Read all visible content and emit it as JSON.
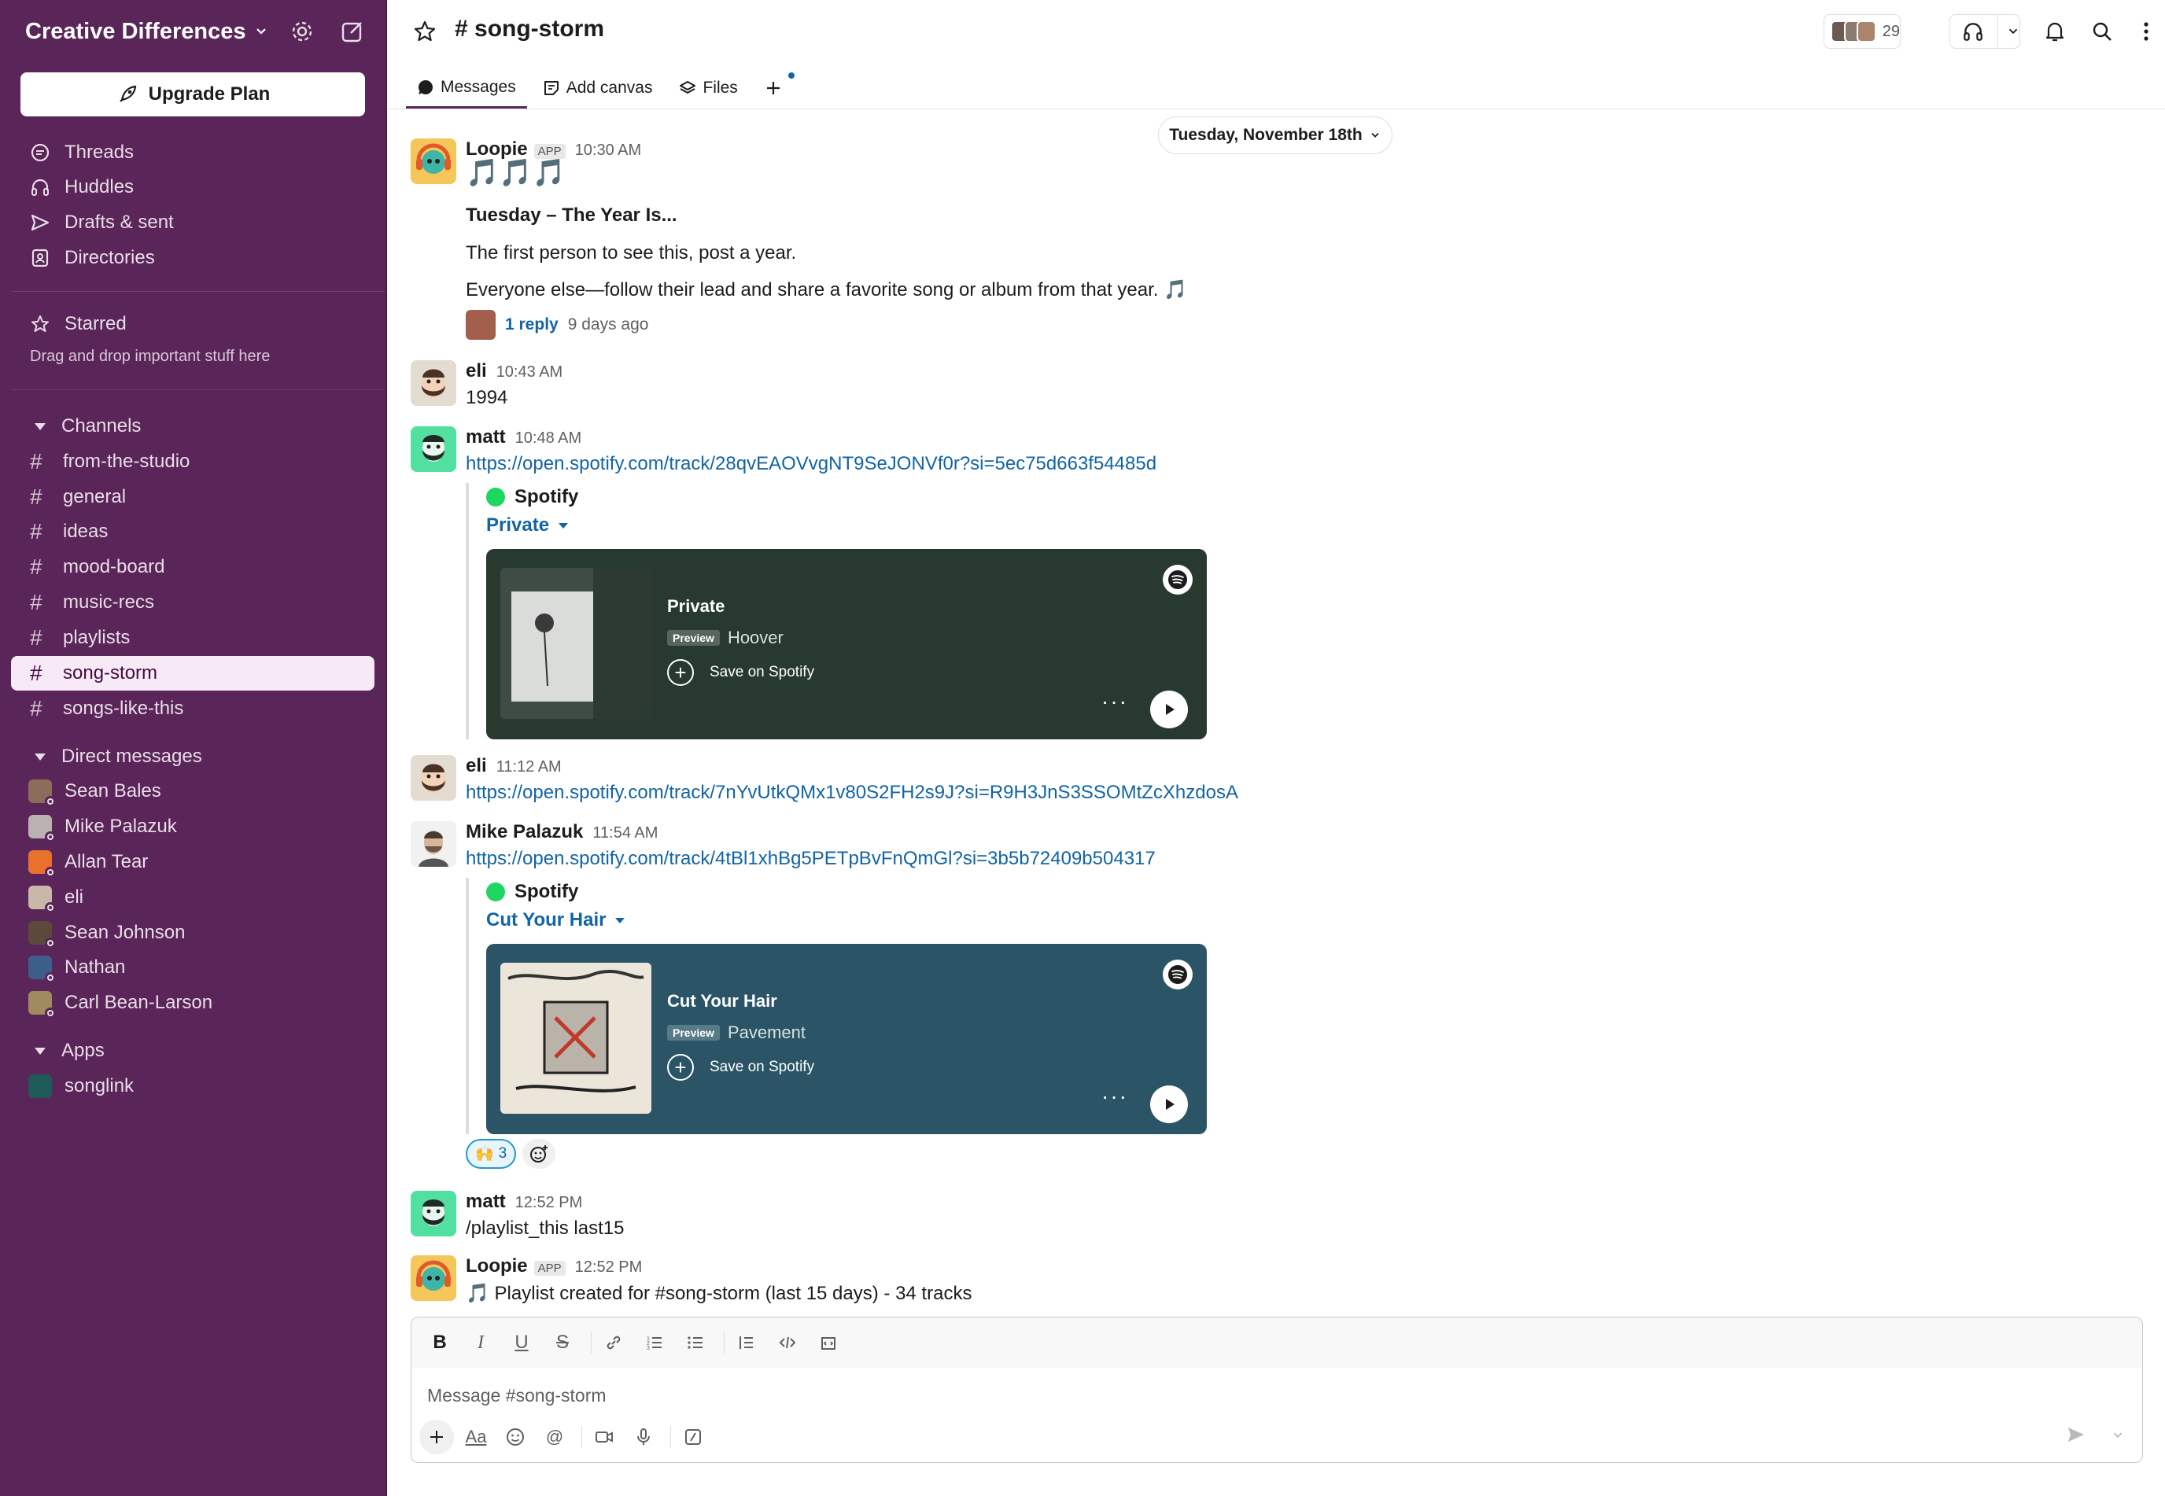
{
  "workspace": {
    "name": "Creative Differences",
    "upgrade_label": "Upgrade Plan"
  },
  "sidebar": {
    "nav": [
      {
        "label": "Threads",
        "icon": "threads-icon"
      },
      {
        "label": "Huddles",
        "icon": "headphones-icon"
      },
      {
        "label": "Drafts & sent",
        "icon": "send-icon"
      },
      {
        "label": "Directories",
        "icon": "directory-icon"
      }
    ],
    "starred_label": "Starred",
    "starred_hint": "Drag and drop important stuff here",
    "channels_label": "Channels",
    "channels": [
      "from-the-studio",
      "general",
      "ideas",
      "mood-board",
      "music-recs",
      "playlists",
      "song-storm",
      "songs-like-this"
    ],
    "active_channel": "song-storm",
    "dms_label": "Direct messages",
    "dms": [
      "Sean Bales",
      "Mike Palazuk",
      "Allan Tear",
      "eli",
      "Sean Johnson",
      "Nathan",
      "Carl Bean-Larson"
    ],
    "apps_label": "Apps",
    "apps": [
      "songlink"
    ]
  },
  "header": {
    "channel": "# song-storm",
    "member_count": "29",
    "tabs": [
      "Messages",
      "Add canvas",
      "Files"
    ]
  },
  "date_divider": "Tuesday, November 18th",
  "messages": [
    {
      "name": "Loopie",
      "badge": "APP",
      "time": "10:30 AM",
      "notes": "🎵🎵🎵",
      "title": "Tuesday – The Year Is...",
      "line1": "The first person to see this, post a year.",
      "line2": "Everyone else—follow their lead and share a favorite song or album from that year. 🎵",
      "reply_count": "1 reply",
      "reply_ago": "9 days ago"
    },
    {
      "name": "eli",
      "time": "10:43 AM",
      "text": "1994"
    },
    {
      "name": "matt",
      "time": "10:48 AM",
      "link": "https://open.spotify.com/track/28qvEAOVvgNT9SeJONVf0r?si=5ec75d663f54485d",
      "unfurl": {
        "source": "Spotify",
        "title": "Private",
        "card_title": "Private",
        "badge": "Preview",
        "artist": "Hoover",
        "save": "Save on Spotify",
        "dots": "···",
        "color": "#283a2f"
      }
    },
    {
      "name": "eli",
      "time": "11:12 AM",
      "link": "https://open.spotify.com/track/7nYvUtkQMx1v80S2FH2s9J?si=R9H3JnS3SSOMtZcXhzdosA"
    },
    {
      "name": "Mike Palazuk",
      "time": "11:54 AM",
      "link": "https://open.spotify.com/track/4tBl1xhBg5PETpBvFnQmGl?si=3b5b72409b504317",
      "unfurl": {
        "source": "Spotify",
        "title": "Cut Your Hair",
        "card_title": "Cut Your Hair",
        "badge": "Preview",
        "artist": "Pavement",
        "save": "Save on Spotify",
        "dots": "···",
        "color": "#2b5566"
      },
      "reaction": {
        "emoji": "🙌",
        "count": "3"
      }
    },
    {
      "name": "matt",
      "time": "12:52 PM",
      "text": "/playlist_this last15"
    },
    {
      "name": "Loopie",
      "badge": "APP",
      "time": "12:52 PM",
      "text": "🎵 Playlist created for #song-storm (last 15 days) - 34 tracks"
    }
  ],
  "composer": {
    "placeholder": "Message #song-storm"
  },
  "colors": {
    "sidebar_bg": "#5a2558",
    "link": "#1264a3",
    "card_private": "#283a2f",
    "card_cut_your_hair": "#2b5566"
  }
}
